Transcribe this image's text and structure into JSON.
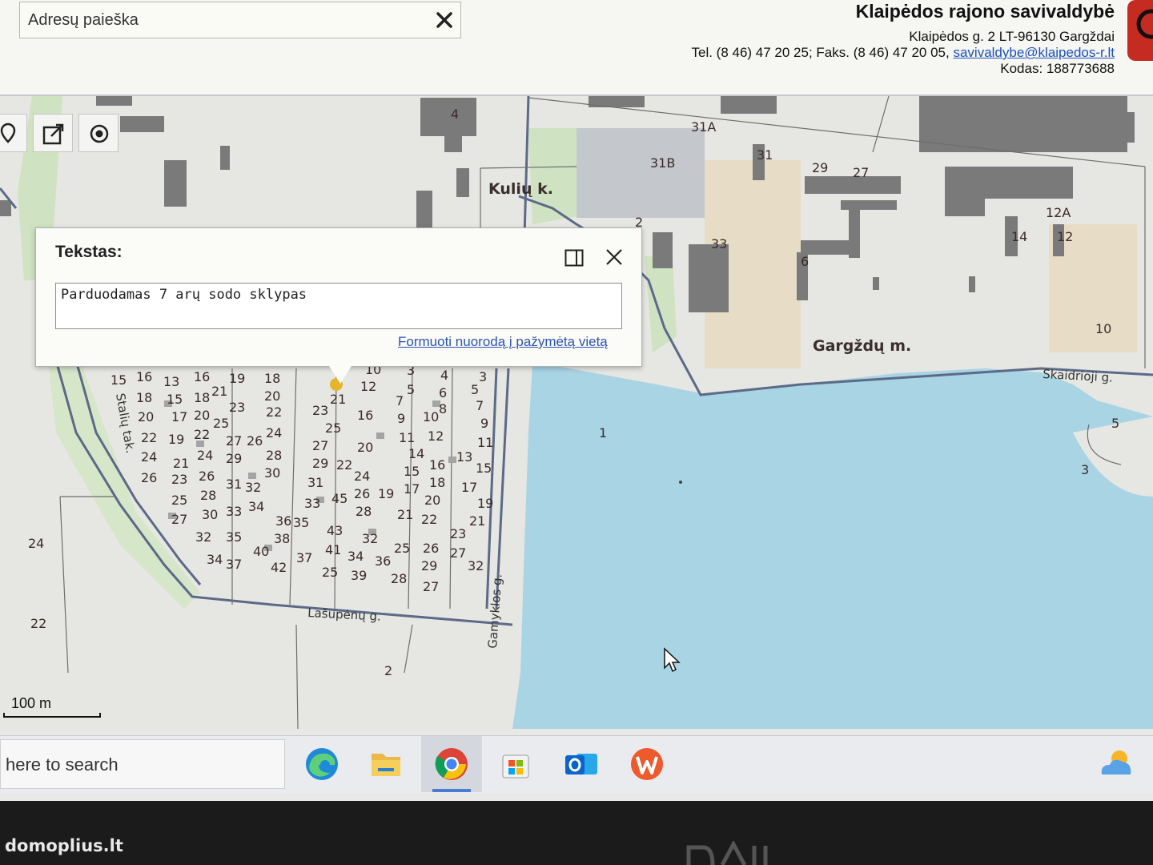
{
  "header": {
    "search": {
      "placeholder": "Adresų paieška"
    },
    "municipality": {
      "name": "Klaipėdos rajono savivaldybė",
      "address": "Klaipėdos g. 2 LT-96130 Gargždai",
      "phone_fax": "Tel. (8 46) 47 20 25; Faks. (8 46) 47 20 05,",
      "email": "savivaldybe@klaipedos-r.lt",
      "code": "Kodas: 188773688"
    }
  },
  "toolbar": {
    "icons": [
      "marker-icon",
      "share-icon",
      "locate-icon"
    ]
  },
  "popup": {
    "title": "Tekstas:",
    "text_value": "Parduodamas 7 arų sodo sklypas",
    "link": "Formuoti nuorodą į pažymėtą vietą"
  },
  "map": {
    "place_labels": {
      "kuliu": "Kulių k.",
      "gargzdu": "Gargždų m."
    },
    "streets": {
      "skaidrioji": "Skaidrioji g.",
      "staliu": "Stalių tak.",
      "lasupenu": "Lašupėnų g.",
      "gamyklos": "Gamyklos g."
    },
    "house_numbers": {
      "n4": "4",
      "n31A": "31A",
      "n31B": "31B",
      "n31": "31",
      "n29": "29",
      "n27": "27",
      "n2": "2",
      "n33": "33",
      "n6": "6",
      "n12A": "12A",
      "n14": "14",
      "n12": "12",
      "n10": "10",
      "n5": "5",
      "n3": "3",
      "n1": "1",
      "n24": "24",
      "n22": "22",
      "n2b": "2"
    },
    "garden_plots": [
      "15",
      "16",
      "13",
      "16",
      "19",
      "18",
      "18",
      "15",
      "18",
      "21",
      "20",
      "20",
      "17",
      "20",
      "25",
      "23",
      "22",
      "22",
      "19",
      "22",
      "27",
      "26",
      "24",
      "24",
      "21",
      "24",
      "29",
      "28",
      "26",
      "23",
      "26",
      "31",
      "32",
      "30",
      "25",
      "28",
      "33",
      "34",
      "27",
      "30",
      "36",
      "35",
      "38",
      "32",
      "35",
      "40",
      "34",
      "37",
      "42",
      "37",
      "10",
      "12",
      "3",
      "4",
      "3",
      "21",
      "5",
      "6",
      "5",
      "23",
      "16",
      "7",
      "9",
      "10",
      "8",
      "7",
      "25",
      "9",
      "27",
      "20",
      "11",
      "12",
      "11",
      "29",
      "22",
      "14",
      "13",
      "15",
      "24",
      "15",
      "16",
      "31",
      "17",
      "18",
      "17",
      "45",
      "26",
      "19",
      "33",
      "28",
      "20",
      "19",
      "21",
      "22",
      "21",
      "43",
      "32",
      "25",
      "26",
      "23",
      "41",
      "34",
      "27",
      "25",
      "39",
      "36",
      "29",
      "28",
      "27",
      "32"
    ],
    "scale": "100 m"
  },
  "taskbar": {
    "search_text": "here to search",
    "apps": [
      "edge-icon",
      "file-explorer-icon",
      "chrome-icon",
      "store-icon",
      "outlook-icon",
      "wps-office-icon",
      "weather-icon"
    ]
  },
  "watermark": "domoplius.lt"
}
